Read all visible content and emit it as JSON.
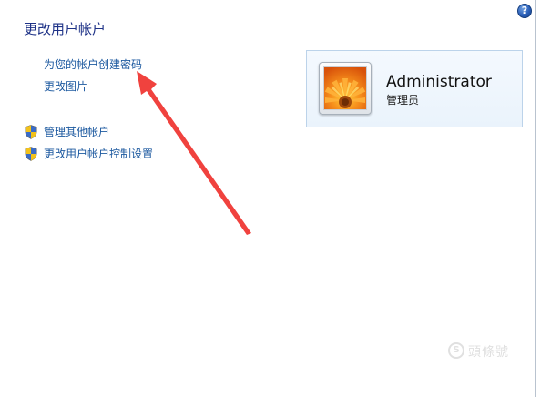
{
  "page": {
    "title": "更改用户帐户"
  },
  "help": {
    "glyph": "?"
  },
  "tasks": {
    "create_password": "为您的帐户创建密码",
    "change_picture": "更改图片"
  },
  "related": {
    "manage_other_accounts": "管理其他帐户",
    "uac_settings": "更改用户帐户控制设置"
  },
  "account": {
    "username": "Administrator",
    "role": "管理员",
    "avatar_icon": "orange-flower-picture"
  },
  "annotation": {
    "arrow_color": "#f0423e"
  },
  "watermark": {
    "logo_glyph": "S",
    "text": "頭條號"
  },
  "colors": {
    "title": "#1e3287",
    "link": "#1e5aa0"
  }
}
